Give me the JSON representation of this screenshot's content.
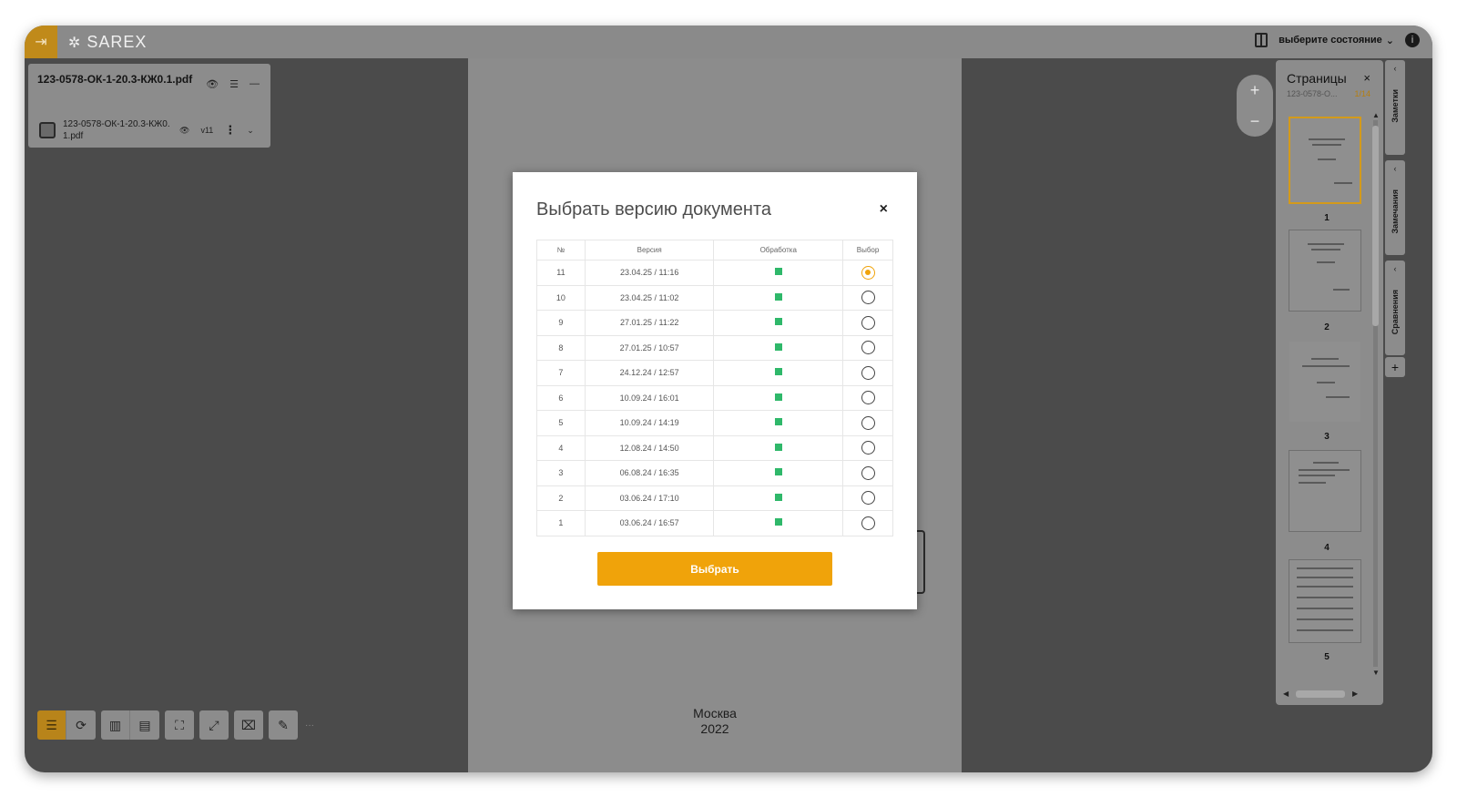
{
  "app": {
    "logo_text": "SAREX",
    "state_select_label": "выберите состояние"
  },
  "file_panel": {
    "title": "123-0578-ОК-1-20.3-КЖ0.1.pdf",
    "file_name": "123-0578-ОК-1-20.3-КЖ0.1.pdf",
    "version_badge": "v11"
  },
  "document": {
    "footer_city": "Москва",
    "footer_year": "2022"
  },
  "pages_panel": {
    "title": "Страницы",
    "subtitle": "123-0578-О...",
    "counter": "1/14",
    "page_numbers": [
      "1",
      "2",
      "3",
      "4",
      "5"
    ]
  },
  "side_tabs": [
    "Заметки",
    "Замечания",
    "Сравнения"
  ],
  "modal": {
    "title": "Выбрать версию документа",
    "close_glyph": "×",
    "columns": {
      "num": "№",
      "version": "Версия",
      "processing": "Обработка",
      "select": "Выбор"
    },
    "rows": [
      {
        "num": "11",
        "version": "23.04.25 / 11:16",
        "selected": true
      },
      {
        "num": "10",
        "version": "23.04.25 / 11:02",
        "selected": false
      },
      {
        "num": "9",
        "version": "27.01.25 / 11:22",
        "selected": false
      },
      {
        "num": "8",
        "version": "27.01.25 / 10:57",
        "selected": false
      },
      {
        "num": "7",
        "version": "24.12.24 / 12:57",
        "selected": false
      },
      {
        "num": "6",
        "version": "10.09.24 / 16:01",
        "selected": false
      },
      {
        "num": "5",
        "version": "10.09.24 / 14:19",
        "selected": false
      },
      {
        "num": "4",
        "version": "12.08.24 / 14:50",
        "selected": false
      },
      {
        "num": "3",
        "version": "06.08.24 / 16:35",
        "selected": false
      },
      {
        "num": "2",
        "version": "03.06.24 / 17:10",
        "selected": false
      },
      {
        "num": "1",
        "version": "03.06.24 / 16:57",
        "selected": false
      }
    ],
    "processing_status_color": "#2fb86a",
    "submit_label": "Выбрать"
  },
  "colors": {
    "accent": "#f0a30a",
    "processed": "#2fb86a"
  }
}
